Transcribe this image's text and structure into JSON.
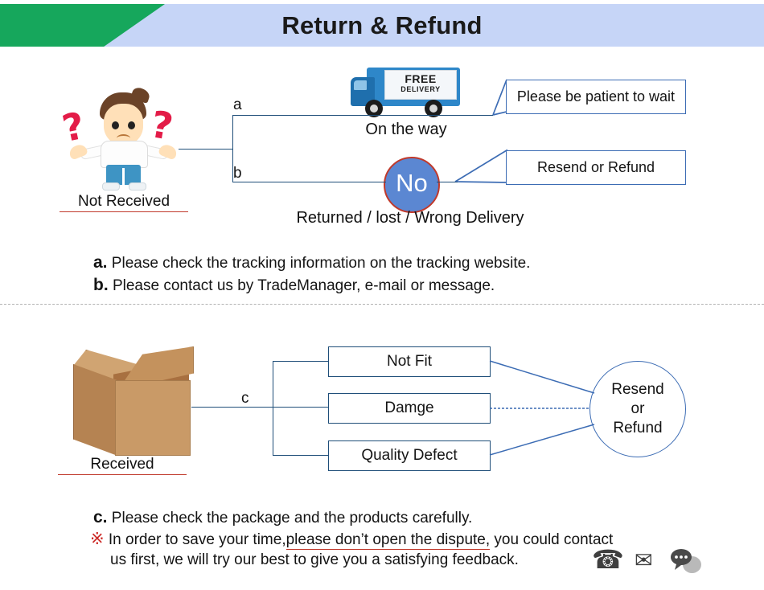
{
  "header": {
    "title": "Return & Refund",
    "band_color": "#c6d5f7",
    "accent_color": "#16a75c"
  },
  "section_not_received": {
    "person_label": "Not Received",
    "person_icon": "confused-person-icon",
    "branch_a_key": "a",
    "branch_b_key": "b",
    "truck": {
      "icon": "delivery-truck-icon",
      "badge_line1": "FREE",
      "badge_line2": "DELIVERY",
      "caption": "On the way"
    },
    "no_circle": {
      "text": "No",
      "fill": "#5b87d2",
      "border": "#c0392b",
      "caption": "Returned / lost / Wrong Delivery"
    },
    "callouts": [
      {
        "text": "Please be patient to wait"
      },
      {
        "text": "Resend or Refund"
      }
    ],
    "notes": [
      {
        "key": "a.",
        "text": "Please check the tracking information on the tracking website."
      },
      {
        "key": "b.",
        "text": "Please contact us by TradeManager, e-mail or message."
      }
    ]
  },
  "section_received": {
    "box_label": "Received",
    "box_icon": "cardboard-box-icon",
    "branch_key": "c",
    "reasons": [
      {
        "text": "Not Fit"
      },
      {
        "text": "Damge"
      },
      {
        "text": "Quality Defect"
      }
    ],
    "outcome": {
      "line1": "Resend",
      "line2": "or",
      "line3": "Refund"
    },
    "notes": [
      {
        "key": "c.",
        "text": "Please check the package and the products carefully."
      }
    ],
    "warning": {
      "marker": "※",
      "marker_color": "#cc2a27",
      "text_before": "In order to save your time,",
      "text_underlined": "please don’t open the dispute,",
      "text_after": " you could  contact",
      "line2": "us first, we will try our best to give you a satisfying feedback.",
      "underline_color": "#c0392b"
    },
    "contact_icons": [
      {
        "name": "telephone-icon",
        "glyph": "☎"
      },
      {
        "name": "envelope-icon",
        "glyph": "✉"
      },
      {
        "name": "chat-bubble-icon",
        "glyph": "●"
      }
    ]
  }
}
